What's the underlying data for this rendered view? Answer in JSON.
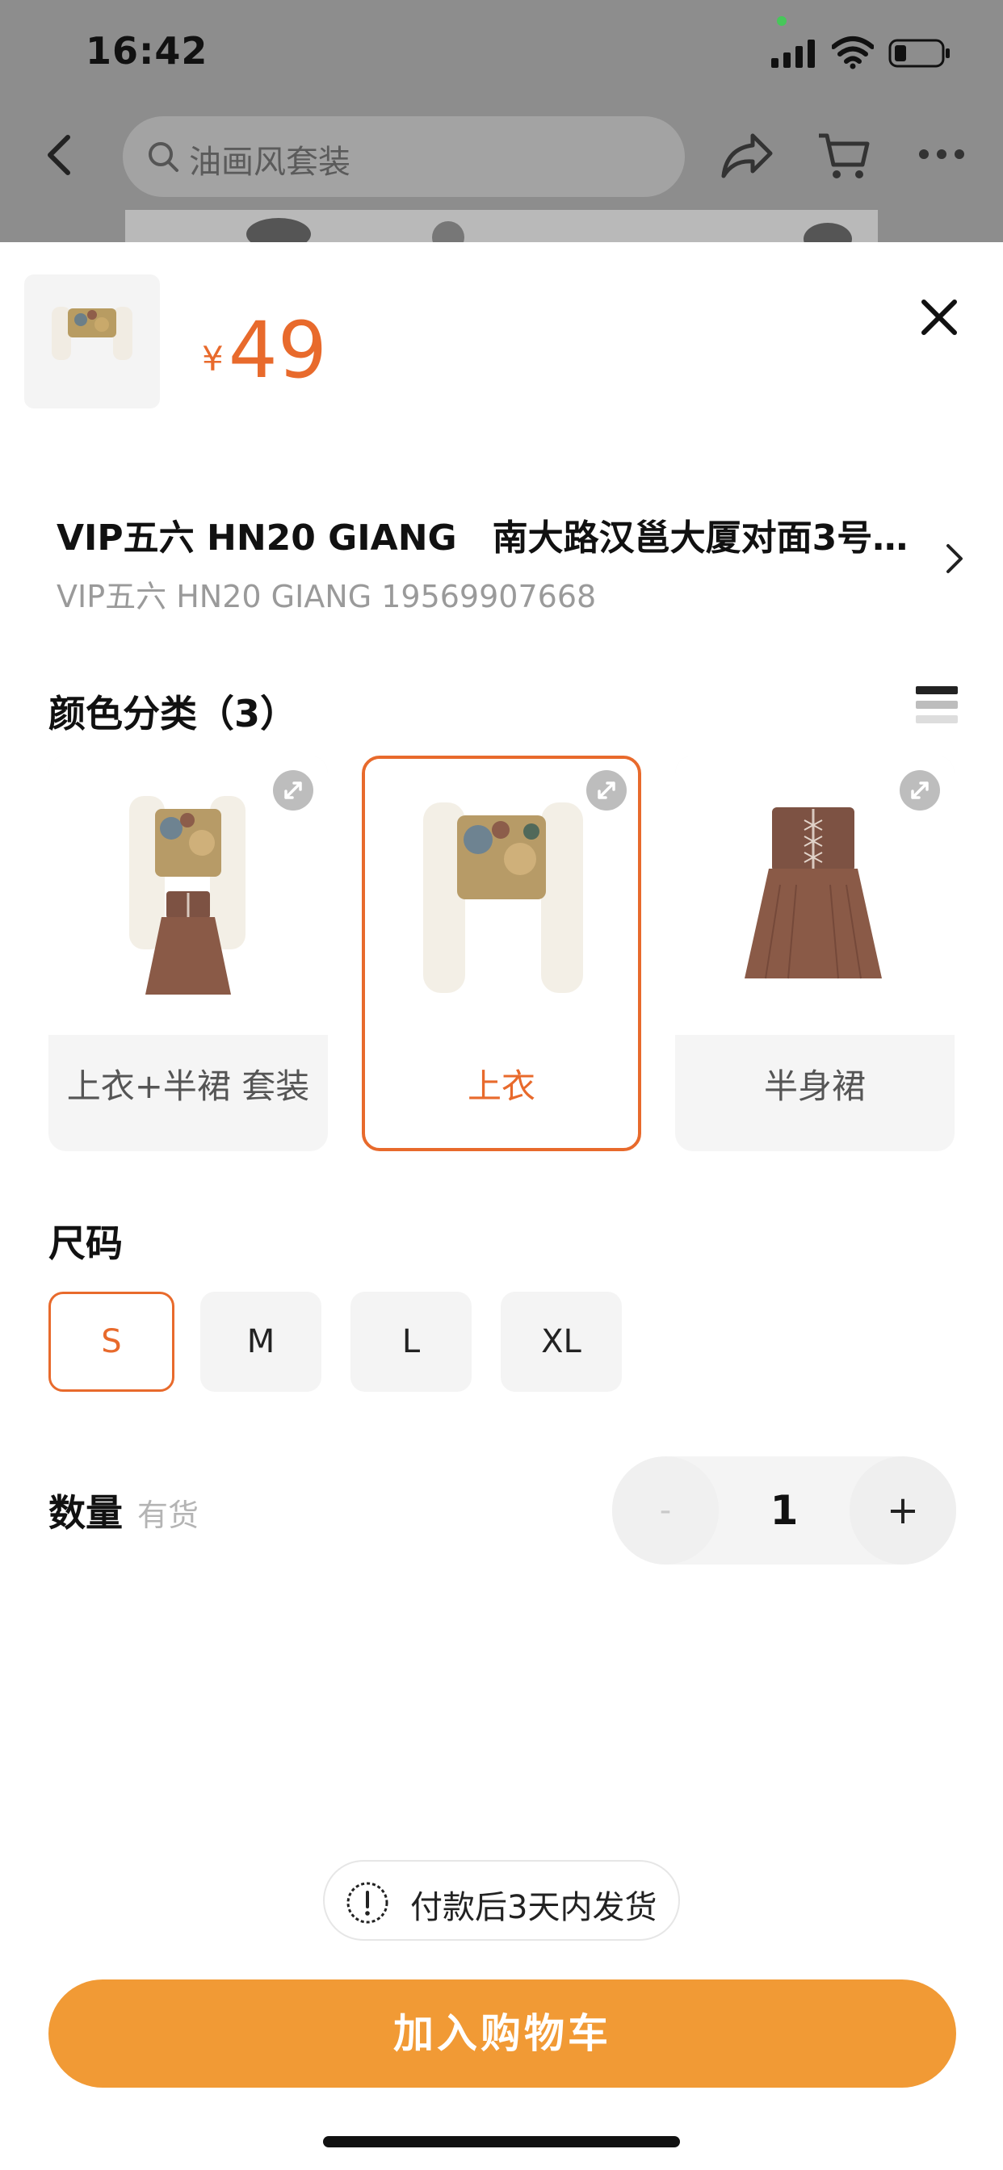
{
  "status_bar": {
    "time": "16:42"
  },
  "nav": {
    "search_placeholder": "油画风套装"
  },
  "product": {
    "currency_symbol": "¥",
    "price": "49"
  },
  "address": {
    "line1": "VIP五六 HN20 GIANG　南大路汉邕大厦对面3号…",
    "line2": "VIP五六  HN20 GIANG 19569907668"
  },
  "color_section": {
    "title": "颜色分类（3）",
    "options": [
      {
        "label": "上衣+半裙 套装",
        "selected": false
      },
      {
        "label": "上衣",
        "selected": true
      },
      {
        "label": "半身裙",
        "selected": false
      }
    ]
  },
  "size_section": {
    "title": "尺码",
    "options": [
      {
        "label": "S",
        "selected": true
      },
      {
        "label": "M",
        "selected": false
      },
      {
        "label": "L",
        "selected": false
      },
      {
        "label": "XL",
        "selected": false
      }
    ]
  },
  "quantity": {
    "label": "数量",
    "stock": "有货",
    "minus": "-",
    "value": "1",
    "plus": "+"
  },
  "shipping_note": "付款后3天内发货",
  "add_to_cart": "加入购物车",
  "colors": {
    "accent": "#e86a2c",
    "button": "#f19a35"
  }
}
